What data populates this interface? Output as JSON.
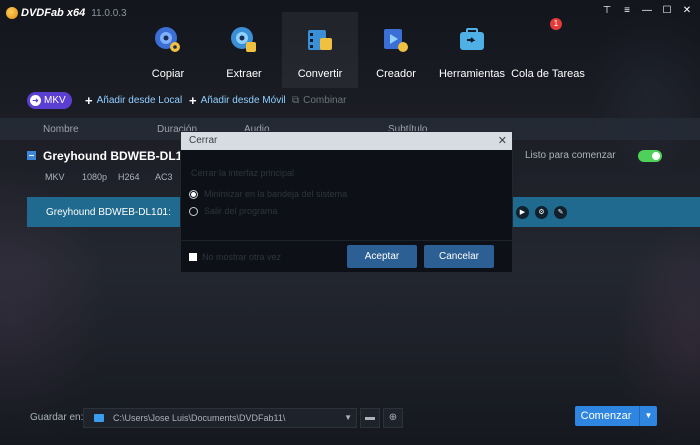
{
  "app": {
    "name": "DVDFab x64",
    "version": "11.0.0.3"
  },
  "window_controls": [
    "pin-icon",
    "menu-icon",
    "minimize-icon",
    "maximize-icon",
    "close-icon"
  ],
  "modules": [
    {
      "label": "Copiar",
      "icon": "disc-copy-icon"
    },
    {
      "label": "Extraer",
      "icon": "disc-ripper-icon"
    },
    {
      "label": "Convertir",
      "icon": "video-converter-icon",
      "active": true
    },
    {
      "label": "Creador",
      "icon": "video-creator-icon"
    },
    {
      "label": "Herramientas",
      "icon": "toolbox-icon"
    },
    {
      "label": "Cola de Tareas",
      "icon": "task-queue-icon",
      "badge": "1"
    }
  ],
  "toolbar": {
    "profile": "MKV",
    "add_local": "Añadir desde Local",
    "add_mobile": "Añadir desde Móvil",
    "merge": "Combinar"
  },
  "table": {
    "headers": {
      "name": "Nombre",
      "duration": "Duración",
      "audio": "Audio",
      "subtitle": "Subtítulo"
    },
    "title": {
      "name": "Greyhound BDWEB-DL1080",
      "status": "Listo para comenzar",
      "meta": [
        "MKV",
        "1080p",
        "H264",
        "AC3"
      ]
    },
    "stream": {
      "name": "Greyhound BDWEB-DL1...",
      "duration": "01:"
    }
  },
  "dialog": {
    "title": "Cerrar",
    "question": "Cerrar la interfaz principal",
    "options": [
      {
        "label": "Minimizar en la bandeja del sistema",
        "checked": true
      },
      {
        "label": "Salir del programa",
        "checked": false
      }
    ],
    "dont_show": "No mostrar otra vez",
    "accept": "Aceptar",
    "cancel": "Cancelar"
  },
  "bottom": {
    "save_label": "Guardar en:",
    "path": "C:\\Users\\Jose Luis\\Documents\\DVDFab11\\",
    "start": "Comenzar"
  },
  "colors": {
    "accent": "#2e86e0",
    "profile": "#5b3fd3",
    "selected_row": "#1f6a8e",
    "toggle_on": "#4fd05a"
  }
}
